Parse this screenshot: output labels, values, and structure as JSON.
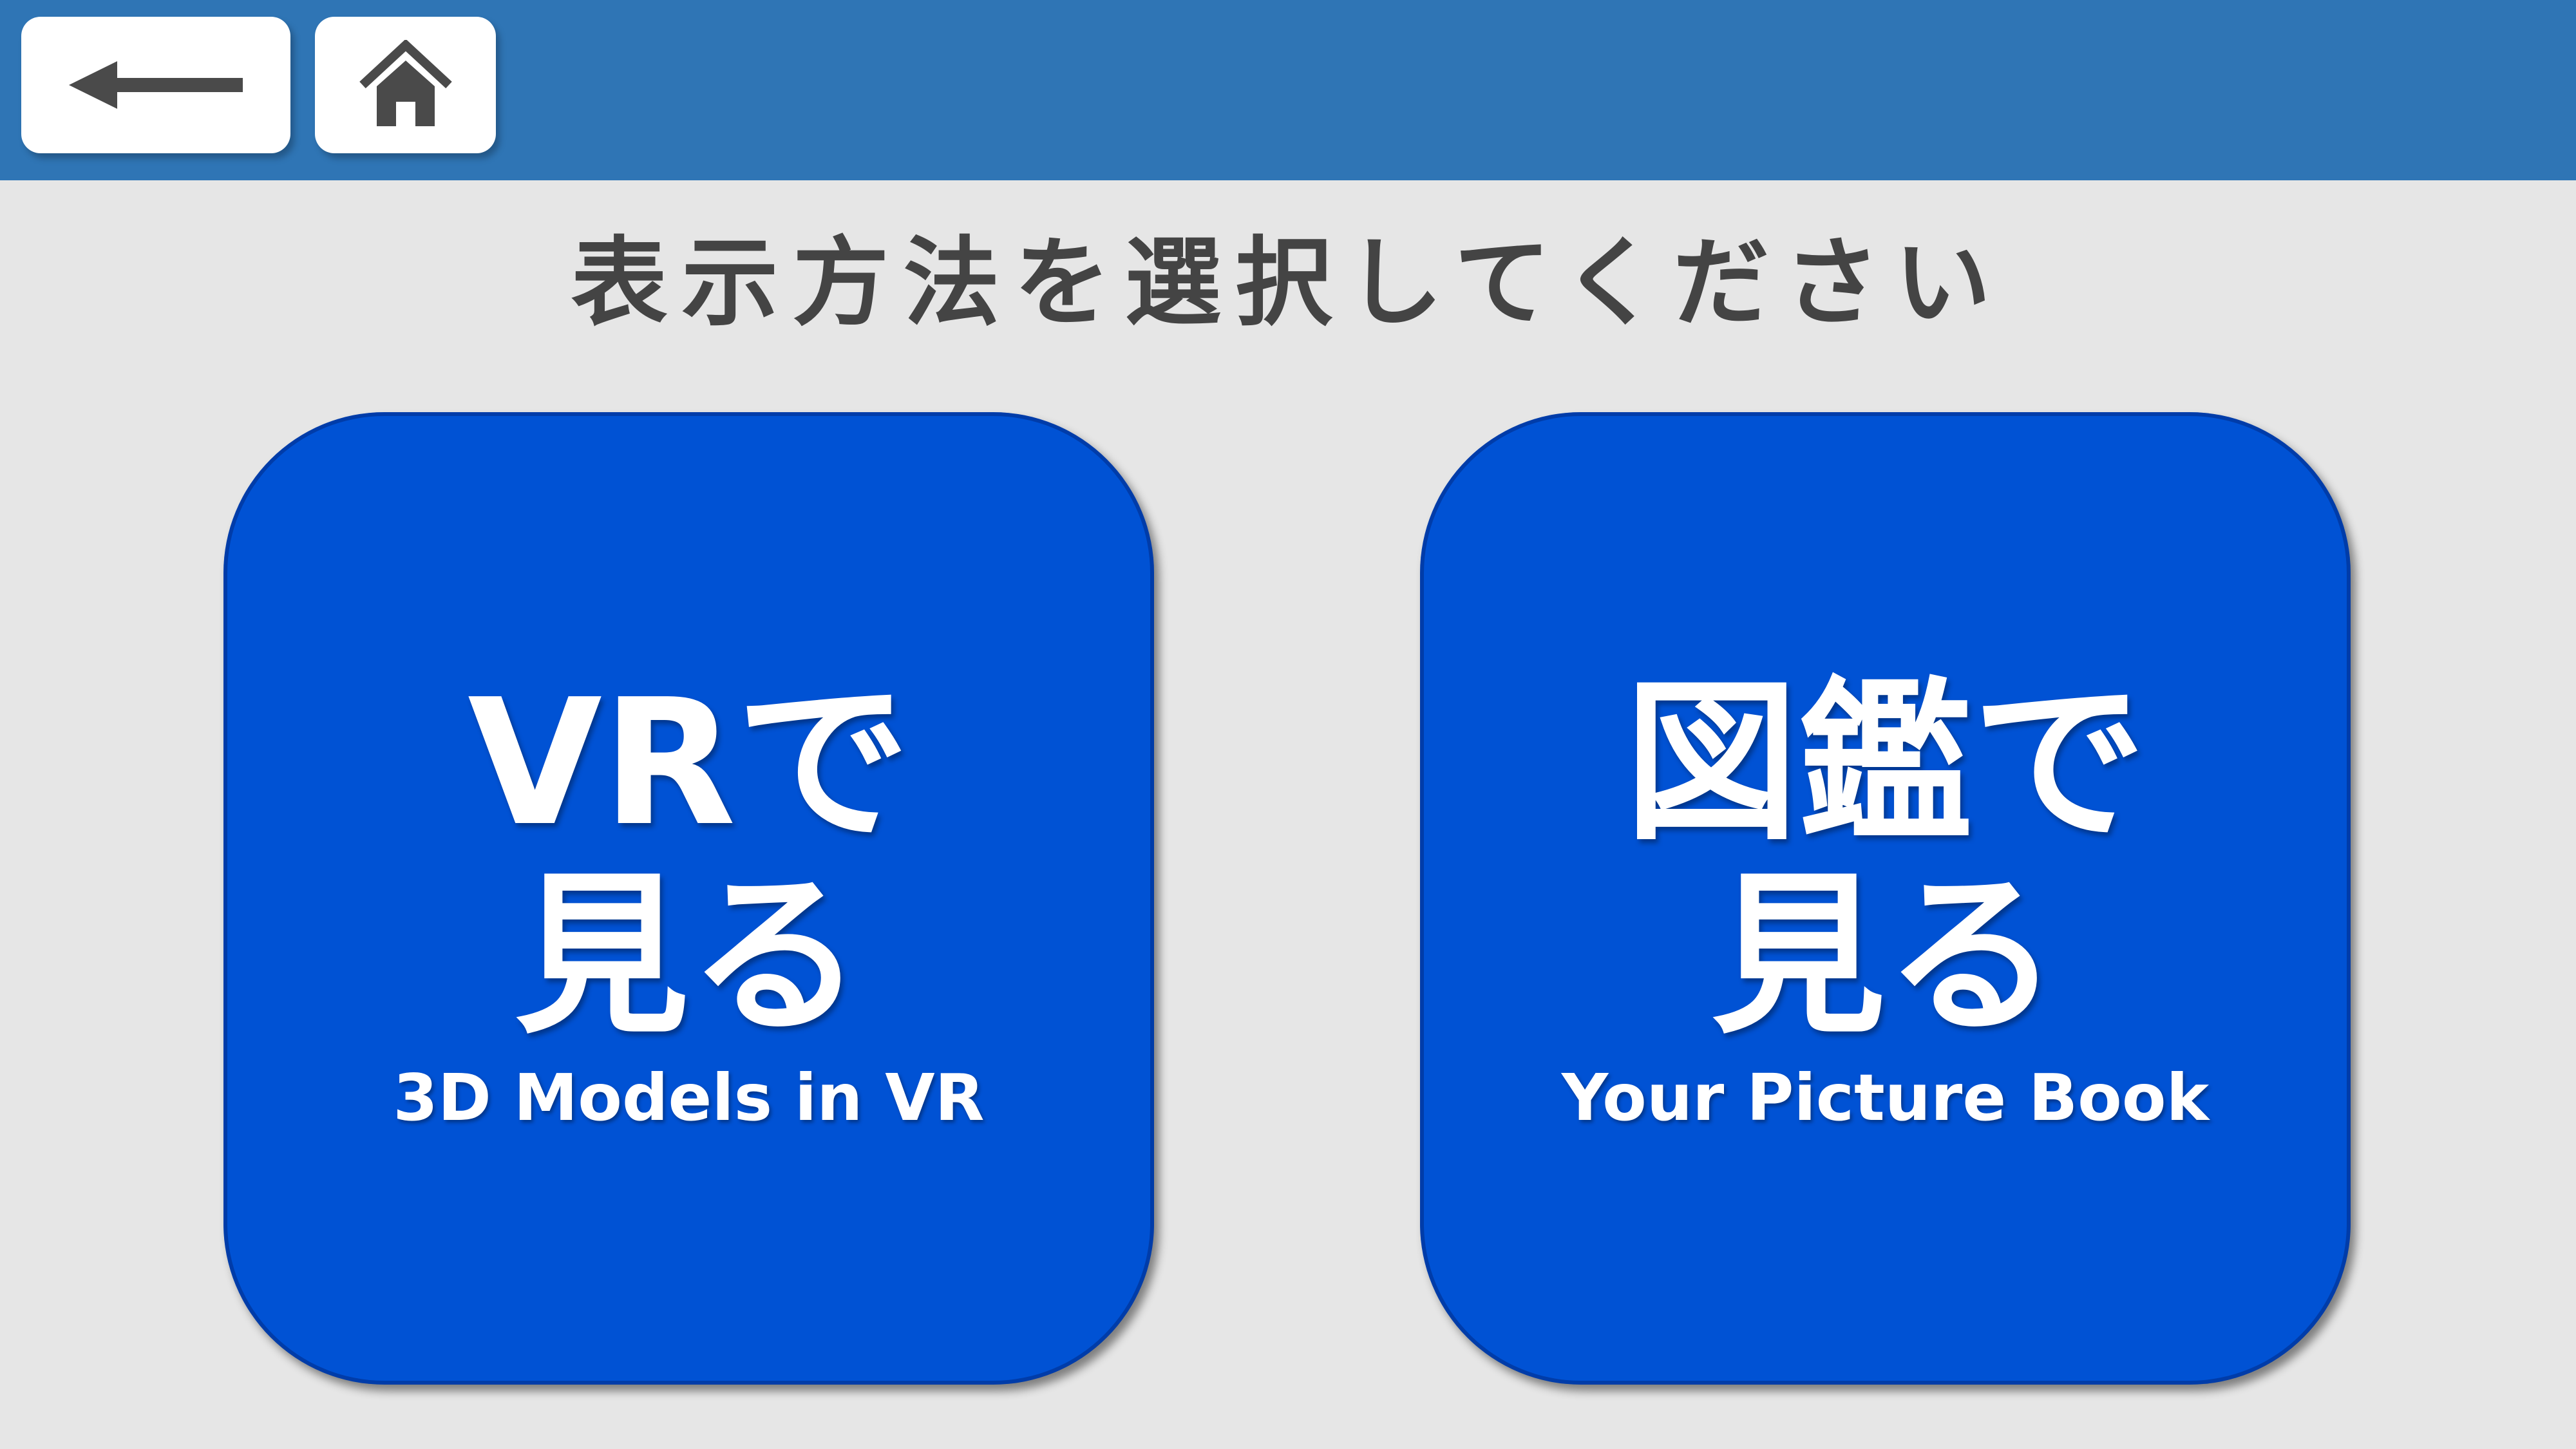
{
  "header": {
    "back_icon": "left-arrow-icon",
    "home_icon": "home-icon",
    "background_color": "#2f75b5"
  },
  "prompt": "表示方法を選択してください",
  "choices": [
    {
      "title_line1": "VRで",
      "title_line2": "見る",
      "subtitle": "3D Models in VR",
      "color": "#0052d4"
    },
    {
      "title_line1": "図鑑で",
      "title_line2": "見る",
      "subtitle": "Your Picture Book",
      "color": "#0052d4"
    }
  ]
}
